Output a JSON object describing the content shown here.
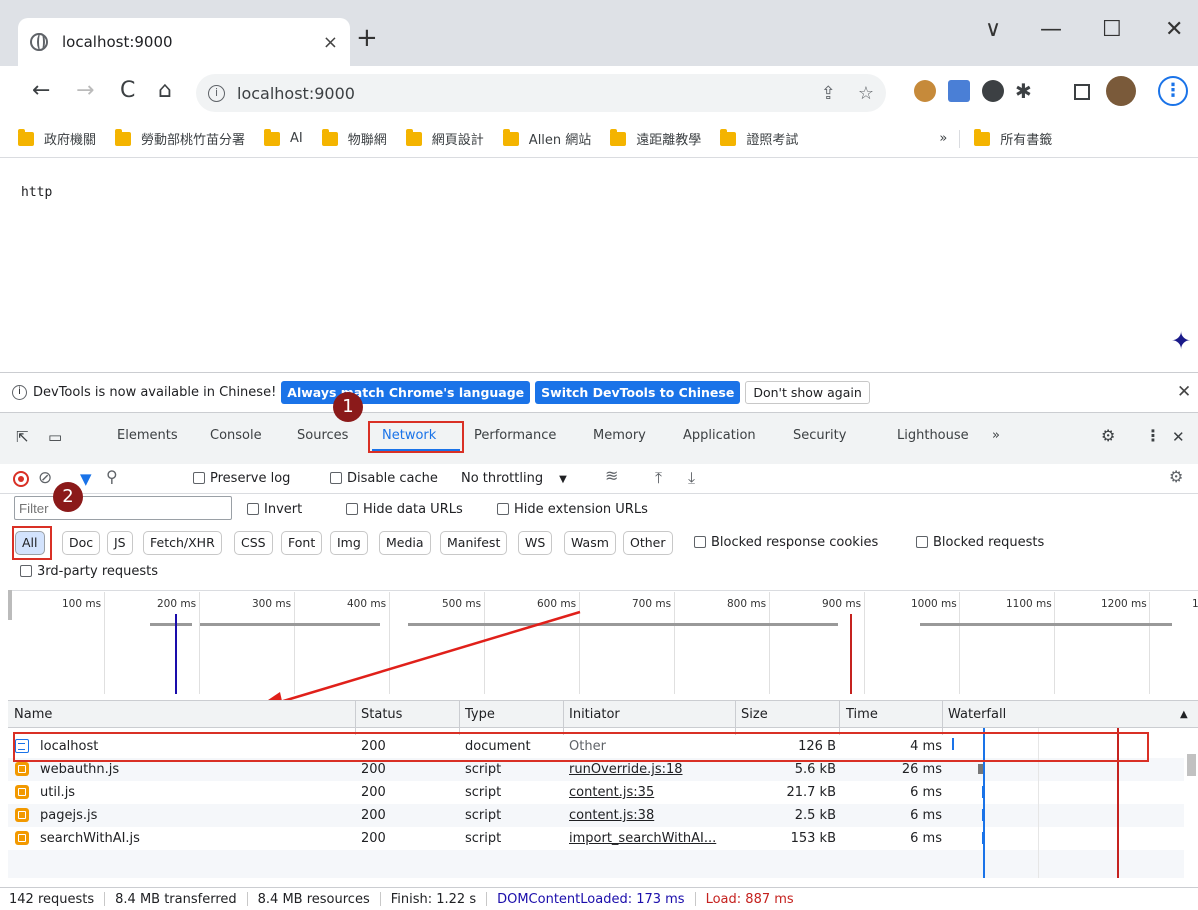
{
  "browser": {
    "tab_title": "localhost:9000",
    "tab_close": "×",
    "new_tab": "+",
    "window_controls": [
      "∨",
      "—",
      "☐",
      "✕"
    ],
    "nav": {
      "back": "←",
      "forward": "→",
      "reload": "C",
      "home": "⌂"
    },
    "address": "localhost:9000"
  },
  "bookmarks": [
    "政府機關",
    "勞動部桃竹苗分署",
    "AI",
    "物聯網",
    "網頁設計",
    "Allen 網站",
    "遠距離教學",
    "證照考試"
  ],
  "bookmarks_more": "»",
  "bookmarks_all": "所有書籤",
  "page": {
    "text": "http"
  },
  "devtools": {
    "infobar": {
      "message": "DevTools is now available in Chinese!",
      "btn_match": "Always match Chrome's language",
      "btn_switch": "Switch DevTools to Chinese",
      "btn_dont": "Don't show again"
    },
    "tabs": [
      "Elements",
      "Console",
      "Sources",
      "Network",
      "Performance",
      "Memory",
      "Application",
      "Security",
      "Lighthouse"
    ],
    "tabs_more": "»",
    "netbar": {
      "preserve_log": "Preserve log",
      "disable_cache": "Disable cache",
      "throttling": "No throttling"
    },
    "filter": {
      "placeholder": "Filter",
      "invert": "Invert",
      "hide_data": "Hide data URLs",
      "hide_ext": "Hide extension URLs"
    },
    "types": [
      "All",
      "Doc",
      "JS",
      "Fetch/XHR",
      "CSS",
      "Font",
      "Img",
      "Media",
      "Manifest",
      "WS",
      "Wasm",
      "Other"
    ],
    "blocked_cookies": "Blocked response cookies",
    "blocked_requests": "Blocked requests",
    "third_party": "3rd-party requests",
    "ticks": [
      "100 ms",
      "200 ms",
      "300 ms",
      "400 ms",
      "500 ms",
      "600 ms",
      "700 ms",
      "800 ms",
      "900 ms",
      "1000 ms",
      "1100 ms",
      "1200 ms",
      "1"
    ],
    "columns": [
      "Name",
      "Status",
      "Type",
      "Initiator",
      "Size",
      "Time",
      "Waterfall"
    ],
    "rows": [
      {
        "name": "localhost",
        "status": "200",
        "type": "document",
        "initiator": "Other",
        "size": "126 B",
        "time": "4 ms",
        "kind": "doc"
      },
      {
        "name": "webauthn.js",
        "status": "200",
        "type": "script",
        "initiator": "runOverride.js:18",
        "size": "5.6 kB",
        "time": "26 ms",
        "kind": "js"
      },
      {
        "name": "util.js",
        "status": "200",
        "type": "script",
        "initiator": "content.js:35",
        "size": "21.7 kB",
        "time": "6 ms",
        "kind": "js"
      },
      {
        "name": "pagejs.js",
        "status": "200",
        "type": "script",
        "initiator": "content.js:38",
        "size": "2.5 kB",
        "time": "6 ms",
        "kind": "js"
      },
      {
        "name": "searchWithAI.js",
        "status": "200",
        "type": "script",
        "initiator": "import_searchWithAI...",
        "size": "153 kB",
        "time": "6 ms",
        "kind": "js"
      }
    ],
    "status": {
      "requests": "142 requests",
      "transferred": "8.4 MB transferred",
      "resources": "8.4 MB resources",
      "finish": "Finish: 1.22 s",
      "dcl": "DOMContentLoaded: 173 ms",
      "load": "Load: 887 ms"
    }
  },
  "annotations": [
    "1",
    "2"
  ],
  "colors": {
    "accent": "#1a73e8",
    "highlight": "#d93025",
    "dcl": "#1a0dab",
    "load": "#c5221f"
  }
}
